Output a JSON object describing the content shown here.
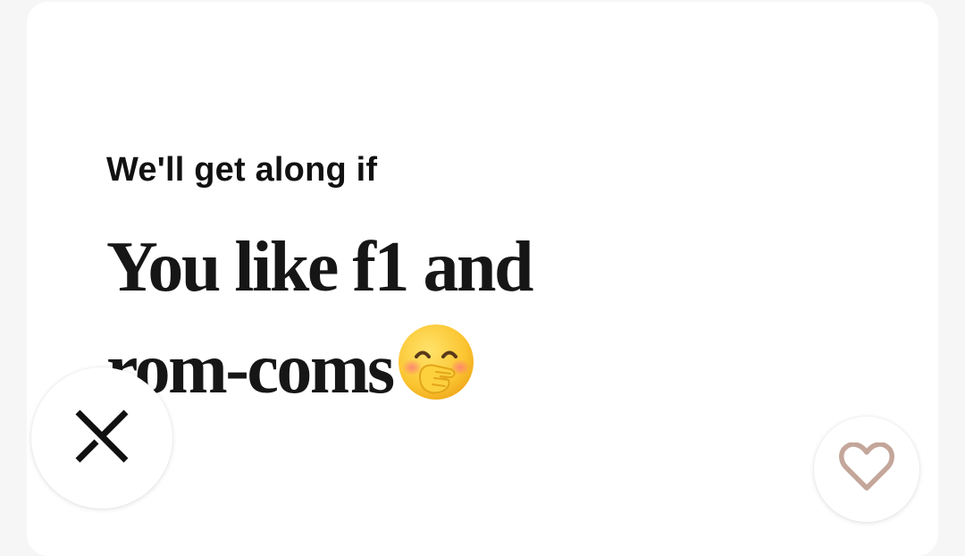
{
  "prompt": {
    "question": "We'll get along if",
    "answer_line1": "You like f1 and",
    "answer_line2": "rom-coms",
    "emoji": "face-with-hand-over-mouth"
  },
  "actions": {
    "skip_icon": "close-icon",
    "like_icon": "heart-icon"
  },
  "colors": {
    "background": "#f6f6f6",
    "card": "#ffffff",
    "text": "#161616",
    "heart": "#c4a69a",
    "skip_x": "#111111"
  }
}
